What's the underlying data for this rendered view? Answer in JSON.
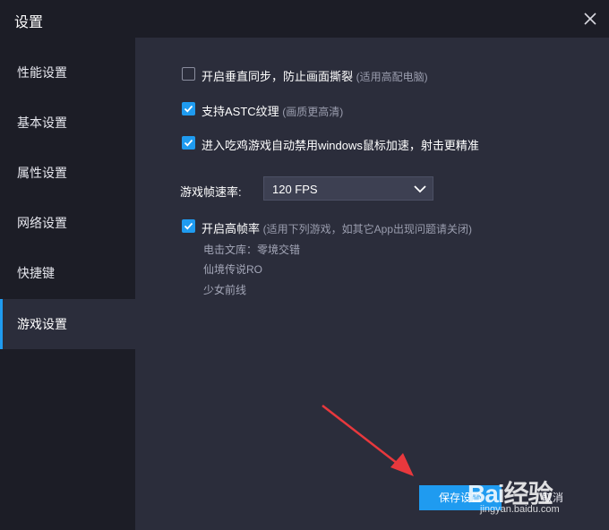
{
  "window": {
    "title": "设置"
  },
  "sidebar": {
    "items": [
      {
        "label": "性能设置",
        "active": false
      },
      {
        "label": "基本设置",
        "active": false
      },
      {
        "label": "属性设置",
        "active": false
      },
      {
        "label": "网络设置",
        "active": false
      },
      {
        "label": "快捷键",
        "active": false
      },
      {
        "label": "游戏设置",
        "active": true
      }
    ]
  },
  "options": [
    {
      "label": "开启垂直同步，防止画面撕裂",
      "hint": "(适用高配电脑)",
      "checked": false
    },
    {
      "label": "支持ASTC纹理",
      "hint": "(画质更高清)",
      "checked": true
    },
    {
      "label": "进入吃鸡游戏自动禁用windows鼠标加速，射击更精准",
      "hint": "",
      "checked": true
    }
  ],
  "fps": {
    "label": "游戏帧速率:",
    "value": "120 FPS"
  },
  "high_fps": {
    "label": "开启高帧率",
    "hint": "(适用下列游戏，如其它App出现问题请关闭)",
    "checked": true,
    "games": [
      "电击文库：零境交错",
      "仙境传说RO",
      "少女前线"
    ]
  },
  "buttons": {
    "save": "保存设置",
    "cancel": "取消"
  },
  "watermark": {
    "main": "Bai经验",
    "sub": "jingyan.baidu.com"
  },
  "colors": {
    "accent": "#1f9bf0",
    "annotation_arrow": "#e8383d"
  }
}
